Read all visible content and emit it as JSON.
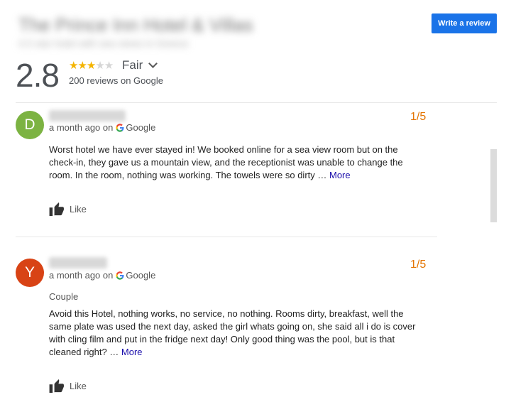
{
  "header": {
    "hotel_name_blurred": "The Prince Inn Hotel & Villas",
    "hotel_sub_blurred": "4.5 star hotel with sea views in Greece",
    "write_review_label": "Write a review"
  },
  "summary": {
    "score": "2.8",
    "stars_filled": 3,
    "stars_total": 5,
    "descriptor": "Fair",
    "review_count_text": "200 reviews on Google"
  },
  "icons": {
    "google": "google-g-icon",
    "like": "thumbs-up-icon",
    "expand": "chevron-down-icon"
  },
  "colors": {
    "accent": "#1a73e8",
    "rating": "#e37400",
    "star": "#f4b400",
    "avatar_d": "#7cb342",
    "avatar_y": "#d84315",
    "link": "#1a0dab"
  },
  "reviews": [
    {
      "avatar_letter": "D",
      "time": "a month ago",
      "on": "on",
      "source": "Google",
      "rating": "1/5",
      "tag": "",
      "text": "Worst hotel we have ever stayed in! We booked online for a sea view room but on the check-in, they gave us a mountain view, and the receptionist was unable to change the room.  In the room, nothing was working.  The towels were so dirty …",
      "more_label": "More",
      "like_label": "Like"
    },
    {
      "avatar_letter": "Y",
      "time": "a month ago",
      "on": "on",
      "source": "Google",
      "rating": "1/5",
      "tag": "Couple",
      "text": "Avoid this Hotel, nothing works, no service, no nothing. Rooms dirty, breakfast, well the same plate was used the next day, asked the girl whats going on, she said all i do is cover with cling film and put in the fridge next day! Only good thing was the pool, but is that cleaned right? …",
      "more_label": "More",
      "like_label": "Like"
    }
  ]
}
